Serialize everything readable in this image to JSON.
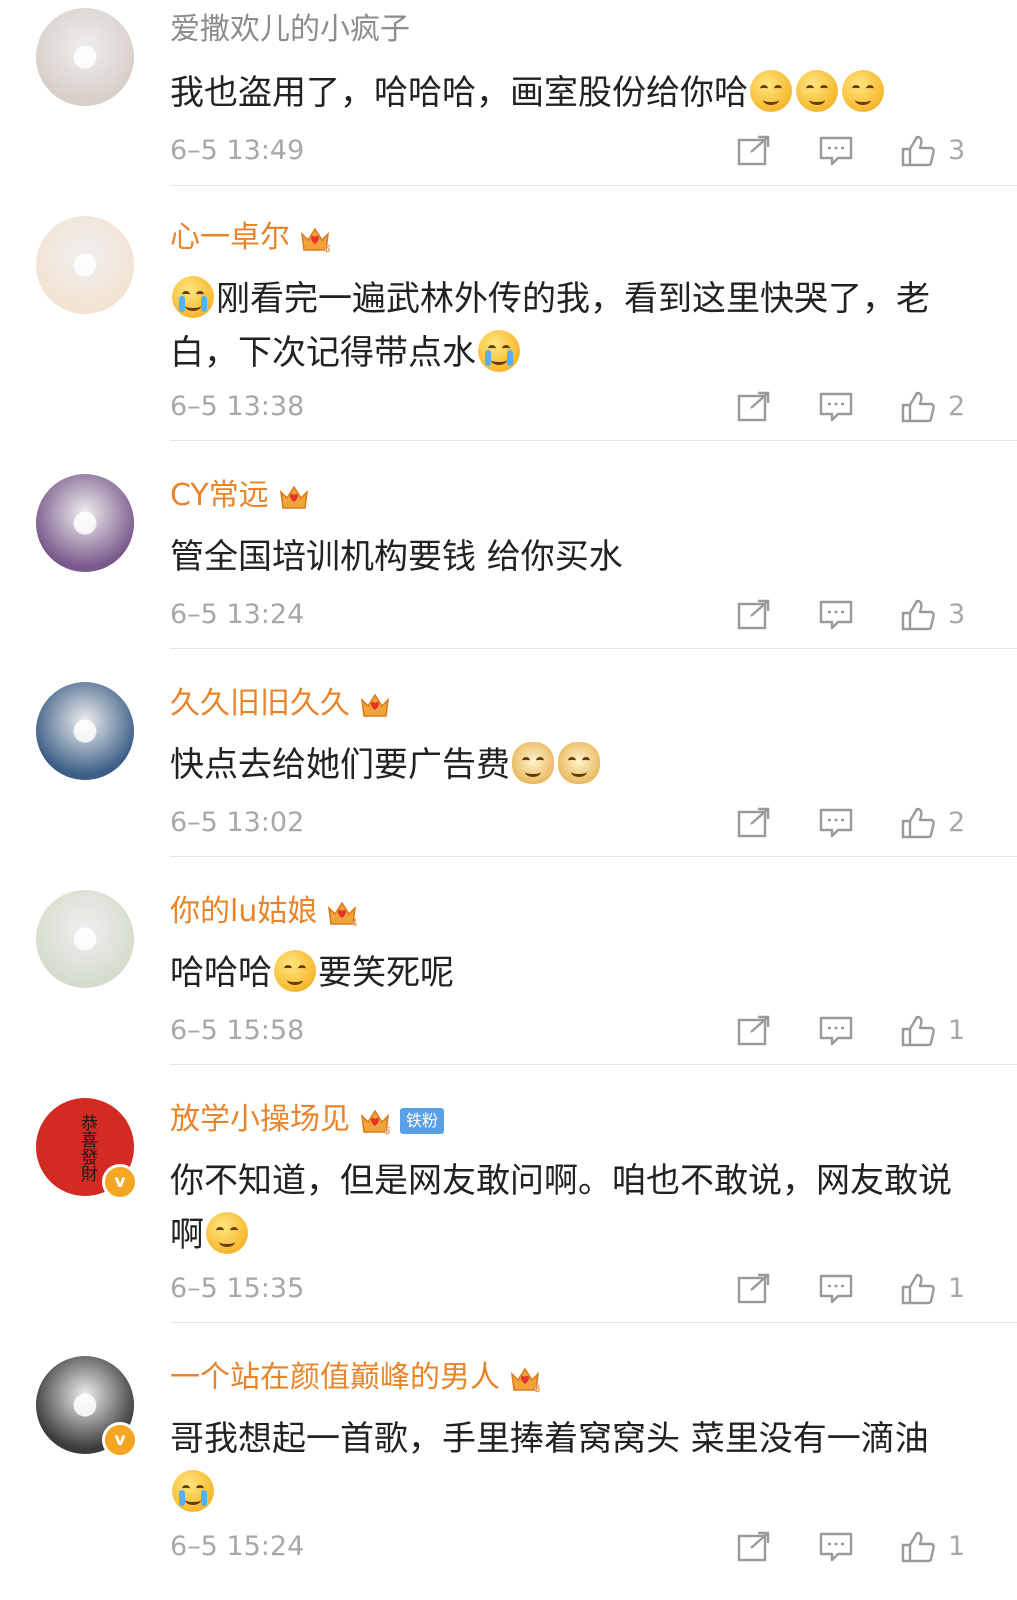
{
  "comments": [
    {
      "name": "爱撒欢儿的小疯子",
      "name_style": "plain",
      "crown": false,
      "crown_level": "",
      "fan_badge": "",
      "verified": false,
      "avatar": {
        "kind": "photo",
        "color": "#d9cfc9"
      },
      "segments": [
        {
          "t": "text",
          "v": "我也盗用了，哈哈哈，画室股份给你哈"
        },
        {
          "t": "emoji",
          "v": "smile"
        },
        {
          "t": "emoji",
          "v": "smile"
        },
        {
          "t": "emoji",
          "v": "smile"
        }
      ],
      "time": "6–5 13:49",
      "likes": "3"
    },
    {
      "name": "心一卓尔",
      "name_style": "orange",
      "crown": true,
      "crown_level": "6",
      "fan_badge": "",
      "verified": false,
      "avatar": {
        "kind": "cartoon",
        "color": "#f3e3d3"
      },
      "segments": [
        {
          "t": "emoji",
          "v": "cry"
        },
        {
          "t": "text",
          "v": "刚看完一遍武林外传的我，看到这里快哭了，老白，下次记得带点水"
        },
        {
          "t": "emoji",
          "v": "laugh-cry"
        }
      ],
      "time": "6–5 13:38",
      "likes": "2"
    },
    {
      "name": "CY常远",
      "name_style": "orange",
      "crown": true,
      "crown_level": "",
      "fan_badge": "",
      "verified": false,
      "avatar": {
        "kind": "photo",
        "color": "#7a5a8c"
      },
      "segments": [
        {
          "t": "text",
          "v": "管全国培训机构要钱 给你买水"
        }
      ],
      "time": "6–5 13:24",
      "likes": "3"
    },
    {
      "name": "久久旧旧久久",
      "name_style": "orange",
      "crown": true,
      "crown_level": "",
      "fan_badge": "",
      "verified": false,
      "avatar": {
        "kind": "cartoon",
        "color": "#3d5f87"
      },
      "segments": [
        {
          "t": "text",
          "v": "快点去给她们要广告费"
        },
        {
          "t": "emoji",
          "v": "doge"
        },
        {
          "t": "emoji",
          "v": "doge"
        }
      ],
      "time": "6–5 13:02",
      "likes": "2"
    },
    {
      "name": "你的lu姑娘",
      "name_style": "orange",
      "crown": true,
      "crown_level": "4",
      "fan_badge": "",
      "verified": false,
      "avatar": {
        "kind": "photo",
        "color": "#d6dccd"
      },
      "segments": [
        {
          "t": "text",
          "v": "哈哈哈"
        },
        {
          "t": "emoji",
          "v": "grin"
        },
        {
          "t": "text",
          "v": "要笑死呢"
        }
      ],
      "time": "6–5 15:58",
      "likes": "1"
    },
    {
      "name": "放学小操场见",
      "name_style": "orange",
      "crown": true,
      "crown_level": "6",
      "fan_badge": "铁粉",
      "verified": true,
      "avatar": {
        "kind": "red-seal",
        "color": "#d42a24",
        "text": "恭喜發財"
      },
      "segments": [
        {
          "t": "text",
          "v": "你不知道，但是网友敢问啊。咱也不敢说，网友敢说啊"
        },
        {
          "t": "emoji",
          "v": "think"
        }
      ],
      "time": "6–5 15:35",
      "likes": "1"
    },
    {
      "name": "一个站在颜值巅峰的男人",
      "name_style": "orange",
      "crown": true,
      "crown_level": "6",
      "fan_badge": "",
      "verified": true,
      "avatar": {
        "kind": "photo",
        "color": "#3b3b3b"
      },
      "segments": [
        {
          "t": "text",
          "v": "哥我想起一首歌，手里捧着窝窝头 菜里没有一滴油"
        },
        {
          "t": "emoji",
          "v": "cry"
        }
      ],
      "time": "6–5 15:24",
      "likes": "1"
    }
  ]
}
